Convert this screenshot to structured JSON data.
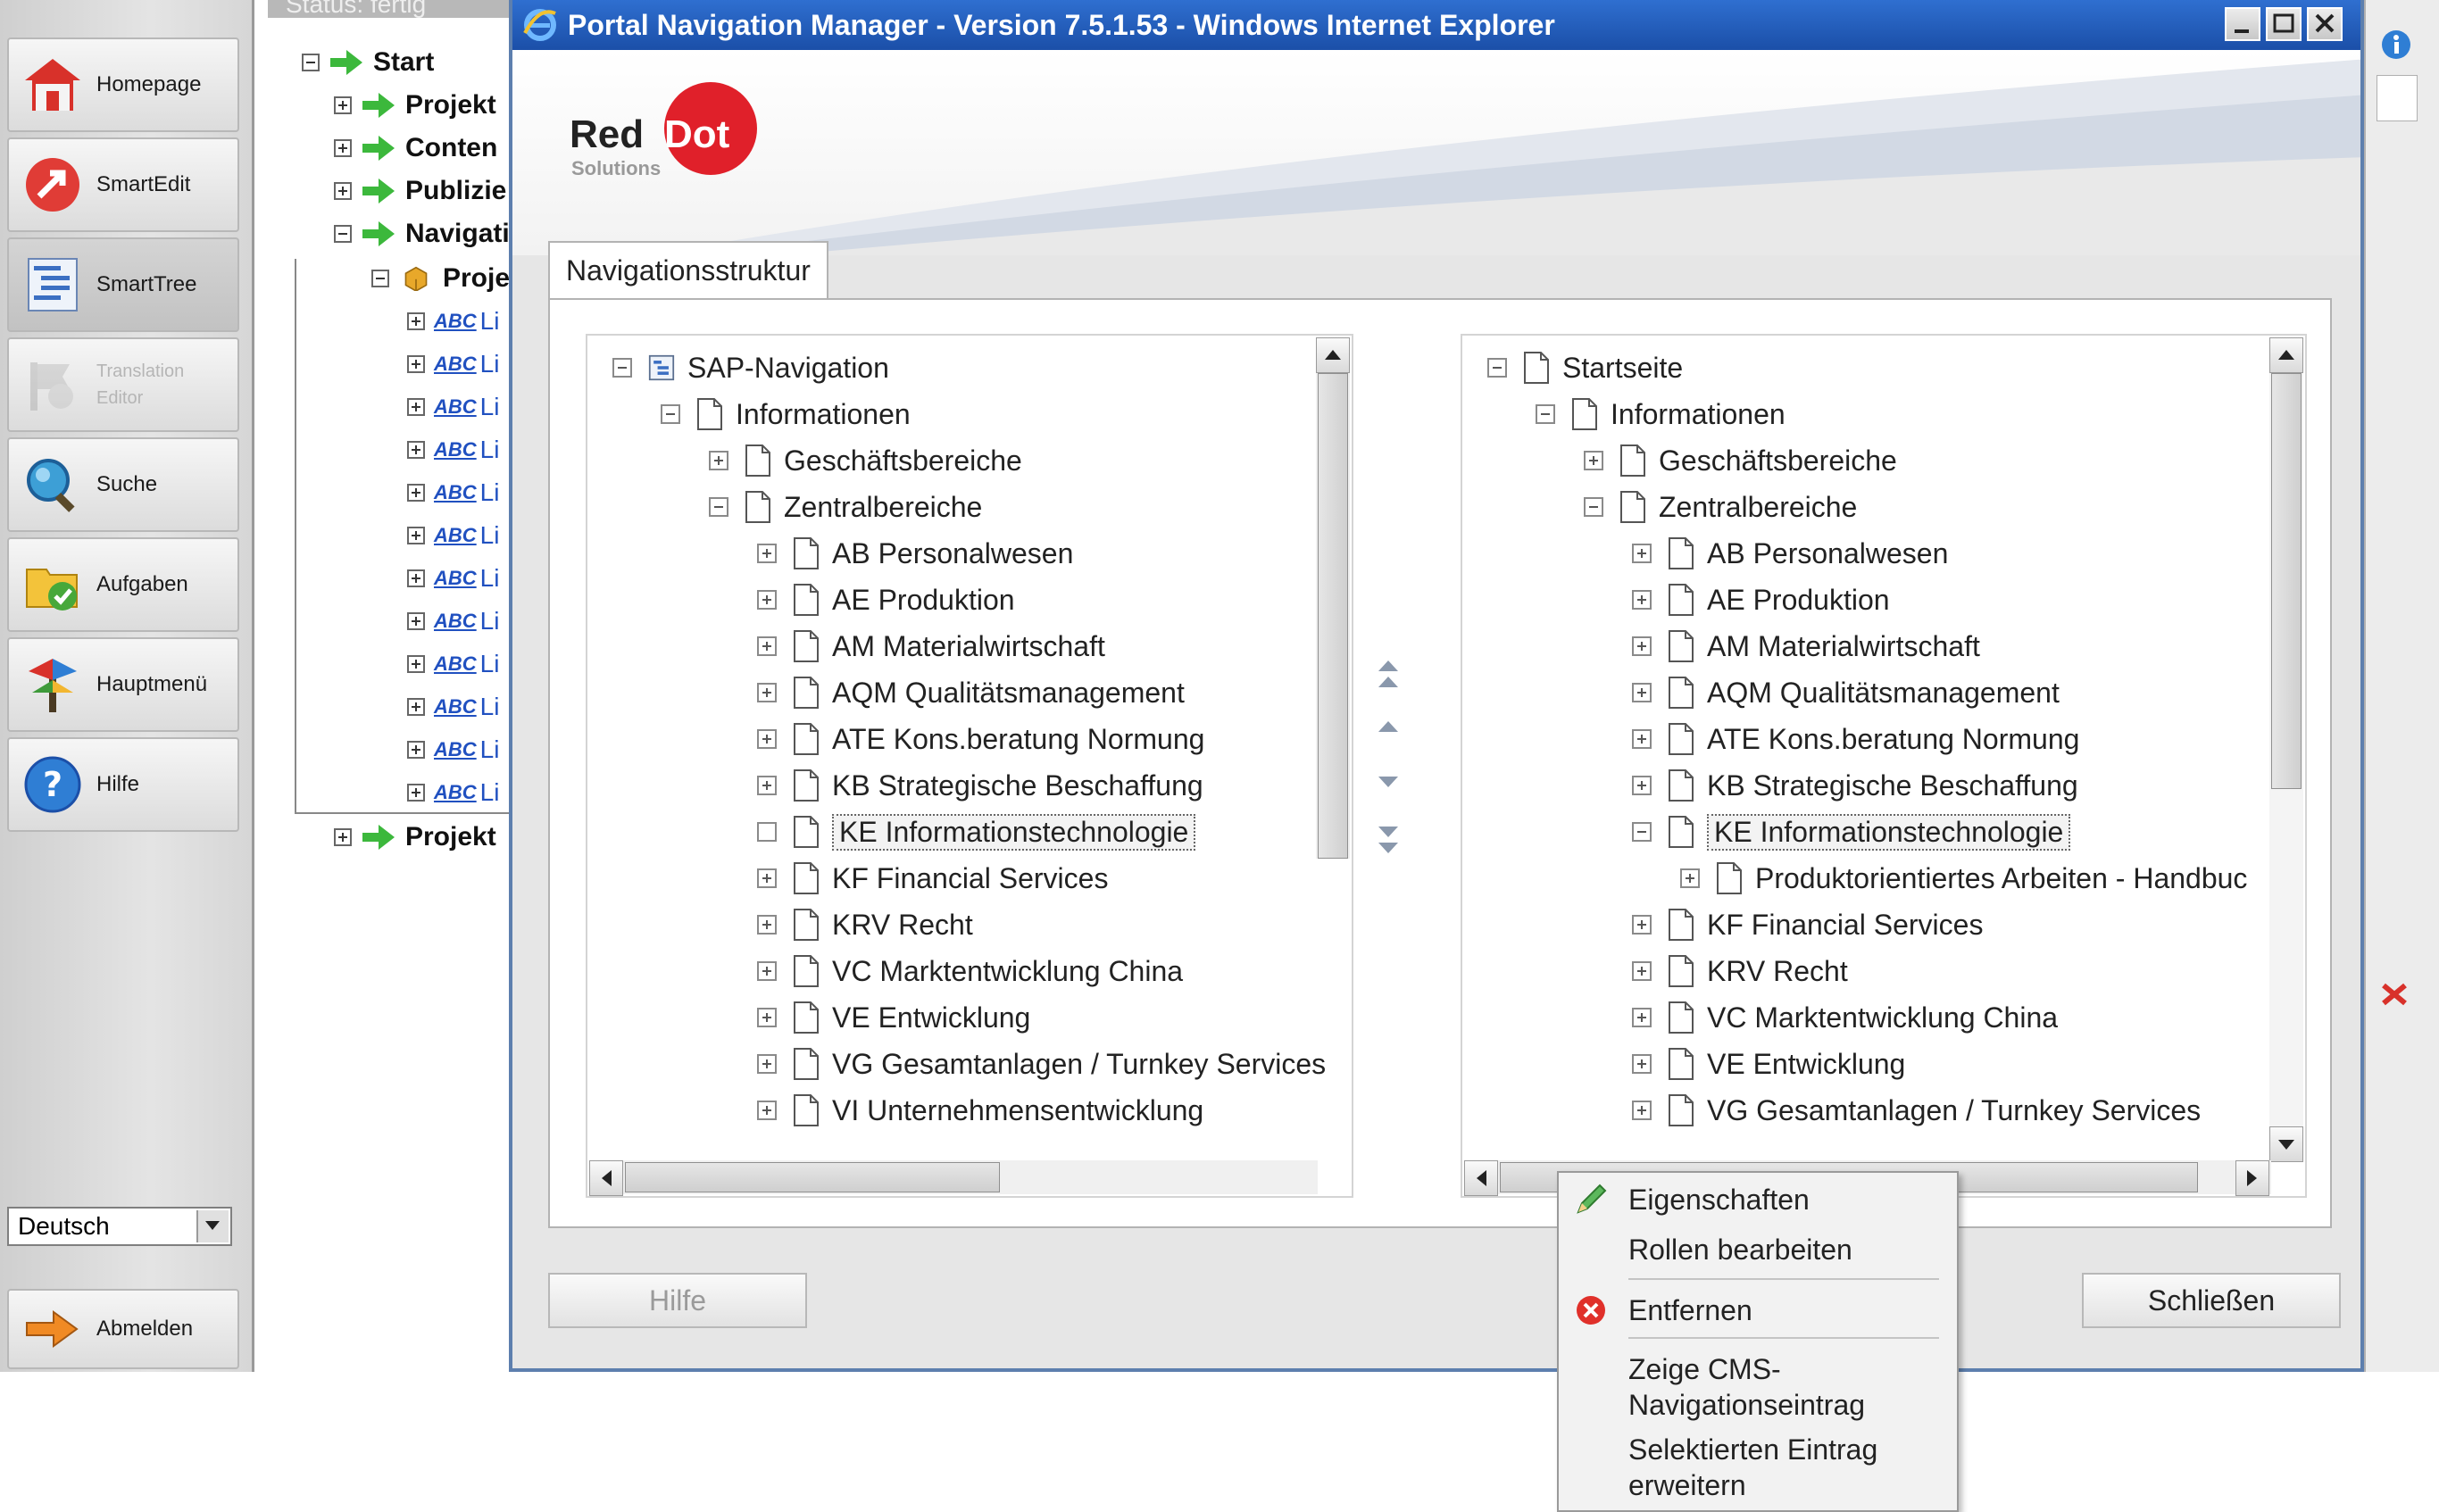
{
  "sidebar": {
    "items": [
      {
        "label": "Homepage"
      },
      {
        "label": "SmartEdit"
      },
      {
        "label": "SmartTree"
      },
      {
        "label": "Translation Editor"
      },
      {
        "label": "Suche"
      },
      {
        "label": "Aufgaben"
      },
      {
        "label": "Hauptmenü"
      },
      {
        "label": "Hilfe"
      }
    ],
    "language": "Deutsch",
    "logout": "Abmelden"
  },
  "bgtree": {
    "status": "Status: fertig",
    "nodes": [
      "Start",
      "Projekt",
      "Conten",
      "Publizie",
      "Navigati",
      "Proje",
      "Projekt"
    ],
    "abc_label": "ABC",
    "abc_suffix": "Li"
  },
  "window": {
    "title": "Portal Navigation Manager - Version 7.5.1.53 - Windows Internet Explorer",
    "logo_red": "Red",
    "logo_dot": "Dot",
    "logo_sub": "Solutions",
    "tab": "Navigationsstruktur"
  },
  "left_tree": {
    "root": "SAP-Navigation",
    "rows": [
      "Informationen",
      "Geschäftsbereiche",
      "Zentralbereiche",
      "AB Personalwesen",
      "AE Produktion",
      "AM Materialwirtschaft",
      "AQM Qualitätsmanagement",
      "ATE Kons.beratung Normung",
      "KB Strategische Beschaffung",
      "KE Informationstechnologie",
      "KF Financial Services",
      "KRV Recht",
      "VC Marktentwicklung China",
      "VE Entwicklung",
      "VG Gesamtanlagen / Turnkey Services",
      "VI Unternehmensentwicklung"
    ]
  },
  "right_tree": {
    "root": "Startseite",
    "rows": [
      "Informationen",
      "Geschäftsbereiche",
      "Zentralbereiche",
      "AB Personalwesen",
      "AE Produktion",
      "AM Materialwirtschaft",
      "AQM Qualitätsmanagement",
      "ATE Kons.beratung Normung",
      "KB Strategische Beschaffung",
      "KE Informationstechnologie",
      "Produktorientiertes Arbeiten - Handbuc",
      "KF Financial Services",
      "KRV Recht",
      "VC Marktentwicklung China",
      "VE Entwicklung",
      "VG Gesamtanlagen / Turnkey Services"
    ]
  },
  "context_menu": {
    "properties": "Eigenschaften",
    "edit_roles": "Rollen bearbeiten",
    "remove": "Entfernen",
    "show_cms_1": "Zeige CMS-",
    "show_cms_2": "Navigationseintrag",
    "expand_1": "Selektierten Eintrag",
    "expand_2": "erweitern"
  },
  "footer": {
    "help": "Hilfe",
    "close": "Schließen"
  },
  "colors": {
    "titlebar": "#1b4fa8",
    "accent_red": "#e0202a"
  }
}
